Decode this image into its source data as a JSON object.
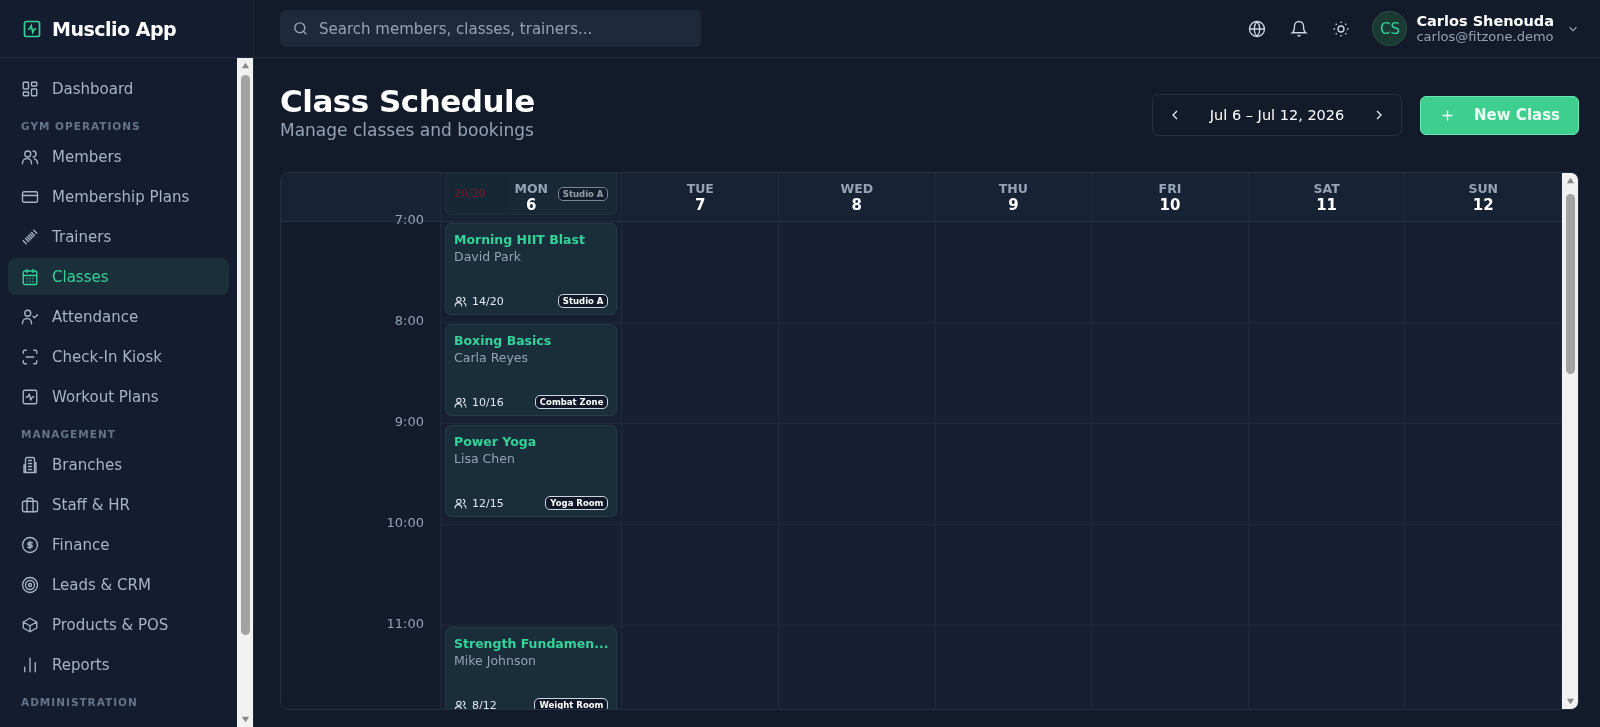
{
  "app": {
    "name": "Musclio App"
  },
  "sidebar": {
    "sections": [
      {
        "items": [
          {
            "label": "Dashboard",
            "selected": false
          }
        ]
      },
      {
        "title": "GYM OPERATIONS",
        "items": [
          {
            "label": "Members",
            "selected": false
          },
          {
            "label": "Membership Plans",
            "selected": false
          },
          {
            "label": "Trainers",
            "selected": false
          },
          {
            "label": "Classes",
            "selected": true
          },
          {
            "label": "Attendance",
            "selected": false
          },
          {
            "label": "Check-In Kiosk",
            "selected": false
          },
          {
            "label": "Workout Plans",
            "selected": false
          }
        ]
      },
      {
        "title": "MANAGEMENT",
        "items": [
          {
            "label": "Branches",
            "selected": false
          },
          {
            "label": "Staff & HR",
            "selected": false
          },
          {
            "label": "Finance",
            "selected": false
          },
          {
            "label": "Leads & CRM",
            "selected": false
          },
          {
            "label": "Products & POS",
            "selected": false
          },
          {
            "label": "Reports",
            "selected": false
          }
        ]
      },
      {
        "title": "ADMINISTRATION"
      }
    ]
  },
  "search": {
    "placeholder": "Search members, classes, trainers..."
  },
  "user": {
    "initials": "CS",
    "name": "Carlos Shenouda",
    "email": "carlos@fitzone.demo"
  },
  "page": {
    "title": "Class Schedule",
    "subtitle": "Manage classes and bookings"
  },
  "date_range": "Jul 6 – Jul 12, 2026",
  "new_class_button": "New Class",
  "calendar": {
    "times": [
      "7:00",
      "8:00",
      "9:00",
      "10:00",
      "11:00"
    ],
    "days": [
      {
        "dow": "MON",
        "date": "6",
        "peek": {
          "count": "20/20",
          "room": "Studio A",
          "full": true
        },
        "slots": [
          {
            "kind": "class",
            "title": "Morning HIIT Blast",
            "trainer": "David Park",
            "count": "14/20",
            "room": "Studio A",
            "full": false
          },
          {
            "kind": "class",
            "title": "Boxing Basics",
            "trainer": "Carla Reyes",
            "count": "10/16",
            "room": "Combat Zone",
            "full": false
          },
          {
            "kind": "class",
            "title": "Power Yoga",
            "trainer": "Lisa Chen",
            "count": "12/15",
            "room": "Yoga Room",
            "full": false
          },
          {
            "kind": "empty"
          },
          {
            "kind": "class",
            "title": "Strength Fundamen...",
            "trainer": "Mike Johnson",
            "count": "8/12",
            "room": "Weight Room",
            "full": false
          }
        ]
      },
      {
        "dow": "TUE",
        "date": "7"
      },
      {
        "dow": "WED",
        "date": "8"
      },
      {
        "dow": "THU",
        "date": "9"
      },
      {
        "dow": "FRI",
        "date": "10"
      },
      {
        "dow": "SAT",
        "date": "11"
      },
      {
        "dow": "SUN",
        "date": "12"
      }
    ]
  }
}
